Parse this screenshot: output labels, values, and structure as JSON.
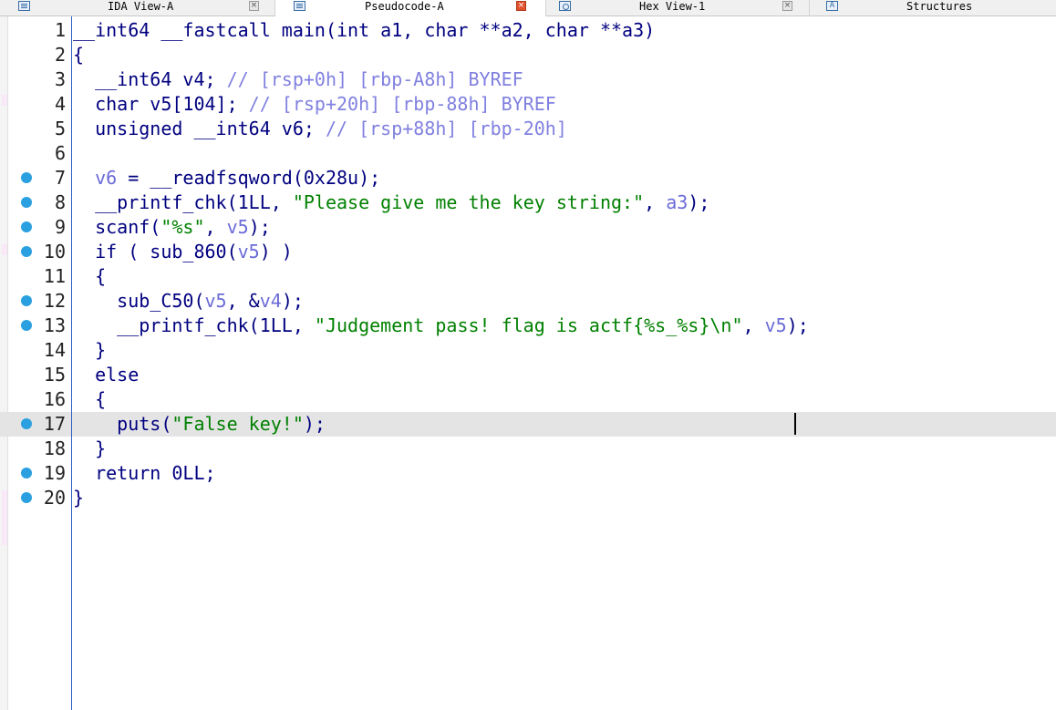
{
  "tabs": [
    {
      "label": "IDA View-A",
      "icon": "disassembly-icon",
      "active": false
    },
    {
      "label": "Pseudocode-A",
      "icon": "pseudocode-icon",
      "active": true
    },
    {
      "label": "Hex View-1",
      "icon": "hex-view-icon",
      "active": false
    },
    {
      "label": "Structures",
      "icon": "structures-icon",
      "active": false
    }
  ],
  "close_glyph": "×",
  "structures_glyph": "A",
  "code_lines": [
    {
      "num": "1",
      "breakpoint": false,
      "current": false,
      "tokens": [
        {
          "t": "__int64 __fastcall main(int a1, char **a2, char **a3)",
          "k": "d"
        }
      ]
    },
    {
      "num": "2",
      "breakpoint": false,
      "current": false,
      "tokens": [
        {
          "t": "{",
          "k": "d"
        }
      ]
    },
    {
      "num": "3",
      "breakpoint": false,
      "current": false,
      "tokens": [
        {
          "t": "  __int64 v4; ",
          "k": "d"
        },
        {
          "t": "// [rsp+0h] [rbp-A8h] BYREF",
          "k": "c"
        }
      ]
    },
    {
      "num": "4",
      "breakpoint": false,
      "current": false,
      "tokens": [
        {
          "t": "  char v5[104]; ",
          "k": "d"
        },
        {
          "t": "// [rsp+20h] [rbp-88h] BYREF",
          "k": "c"
        }
      ]
    },
    {
      "num": "5",
      "breakpoint": false,
      "current": false,
      "tokens": [
        {
          "t": "  unsigned __int64 v6; ",
          "k": "d"
        },
        {
          "t": "// [rsp+88h] [rbp-20h]",
          "k": "c"
        }
      ]
    },
    {
      "num": "6",
      "breakpoint": false,
      "current": false,
      "tokens": [
        {
          "t": "",
          "k": "d"
        }
      ]
    },
    {
      "num": "7",
      "breakpoint": true,
      "current": false,
      "tokens": [
        {
          "t": "  ",
          "k": "d"
        },
        {
          "t": "v6",
          "k": "v"
        },
        {
          "t": " = __readfsqword(0x28u);",
          "k": "d"
        }
      ]
    },
    {
      "num": "8",
      "breakpoint": true,
      "current": false,
      "tokens": [
        {
          "t": "  __printf_chk(1LL, ",
          "k": "d"
        },
        {
          "t": "\"Please give me the key string:\"",
          "k": "s"
        },
        {
          "t": ", ",
          "k": "d"
        },
        {
          "t": "a3",
          "k": "v"
        },
        {
          "t": ");",
          "k": "d"
        }
      ]
    },
    {
      "num": "9",
      "breakpoint": true,
      "current": false,
      "tokens": [
        {
          "t": "  scanf(",
          "k": "d"
        },
        {
          "t": "\"%s\"",
          "k": "s"
        },
        {
          "t": ", ",
          "k": "d"
        },
        {
          "t": "v5",
          "k": "v"
        },
        {
          "t": ");",
          "k": "d"
        }
      ]
    },
    {
      "num": "10",
      "breakpoint": true,
      "current": false,
      "tokens": [
        {
          "t": "  if ( sub_860(",
          "k": "d"
        },
        {
          "t": "v5",
          "k": "v"
        },
        {
          "t": ") )",
          "k": "d"
        }
      ]
    },
    {
      "num": "11",
      "breakpoint": false,
      "current": false,
      "tokens": [
        {
          "t": "  {",
          "k": "d"
        }
      ]
    },
    {
      "num": "12",
      "breakpoint": true,
      "current": false,
      "tokens": [
        {
          "t": "    sub_C50(",
          "k": "d"
        },
        {
          "t": "v5",
          "k": "v"
        },
        {
          "t": ", &",
          "k": "d"
        },
        {
          "t": "v4",
          "k": "v"
        },
        {
          "t": ");",
          "k": "d"
        }
      ]
    },
    {
      "num": "13",
      "breakpoint": true,
      "current": false,
      "tokens": [
        {
          "t": "    __printf_chk(1LL, ",
          "k": "d"
        },
        {
          "t": "\"Judgement pass! flag is actf{%s_%s}\\n\"",
          "k": "s"
        },
        {
          "t": ", ",
          "k": "d"
        },
        {
          "t": "v5",
          "k": "v"
        },
        {
          "t": ");",
          "k": "d"
        }
      ]
    },
    {
      "num": "14",
      "breakpoint": false,
      "current": false,
      "tokens": [
        {
          "t": "  }",
          "k": "d"
        }
      ]
    },
    {
      "num": "15",
      "breakpoint": false,
      "current": false,
      "tokens": [
        {
          "t": "  else",
          "k": "d"
        }
      ]
    },
    {
      "num": "16",
      "breakpoint": false,
      "current": false,
      "tokens": [
        {
          "t": "  {",
          "k": "d"
        }
      ]
    },
    {
      "num": "17",
      "breakpoint": true,
      "current": true,
      "tokens": [
        {
          "t": "    puts(",
          "k": "d"
        },
        {
          "t": "\"False key!\"",
          "k": "s"
        },
        {
          "t": ");",
          "k": "d"
        }
      ]
    },
    {
      "num": "18",
      "breakpoint": false,
      "current": false,
      "tokens": [
        {
          "t": "  }",
          "k": "d"
        }
      ]
    },
    {
      "num": "19",
      "breakpoint": true,
      "current": false,
      "tokens": [
        {
          "t": "  return 0LL;",
          "k": "d"
        }
      ]
    },
    {
      "num": "20",
      "breakpoint": true,
      "current": false,
      "tokens": [
        {
          "t": "}",
          "k": "d"
        }
      ]
    }
  ],
  "colors": {
    "code_default": "#000080",
    "variable": "#6b6bd8",
    "comment": "#8080e0",
    "string": "#008000",
    "breakpoint": "#2aa0e0",
    "current_line": "#e4e4e4",
    "gutter_line": "#2f5fc4"
  }
}
